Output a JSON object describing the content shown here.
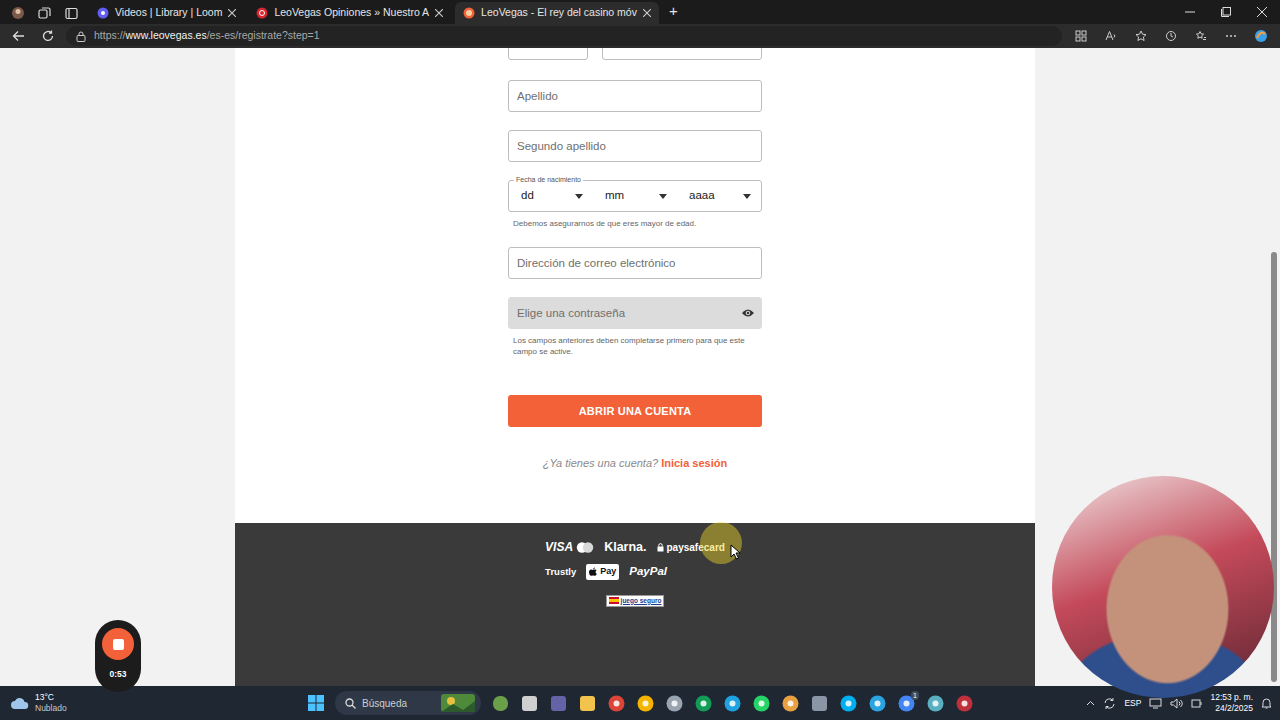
{
  "browser": {
    "tabs": [
      {
        "label": "Videos | Library | Loom",
        "selected": false,
        "kind": "loom"
      },
      {
        "label": "LeoVegas Opiniones » Nuestro A",
        "selected": false,
        "kind": "review"
      },
      {
        "label": "LeoVegas - El rey del casino móv",
        "selected": true,
        "kind": "leovegas"
      }
    ],
    "new_tab": "+",
    "url": {
      "scheme": "https://",
      "host": "www.leovegas.es",
      "path": "/es-es/registrate?step=1"
    }
  },
  "form": {
    "fields": [
      {
        "kind": "text",
        "placeholder": "Apellido",
        "disabled": false
      },
      {
        "kind": "text",
        "placeholder": "Segundo apellido",
        "disabled": false
      },
      {
        "kind": "date",
        "label": "Fecha de nacimiento",
        "parts": [
          "dd",
          "mm",
          "aaaa"
        ],
        "help": "Debemos asegurarnos de que eres mayor de edad."
      },
      {
        "kind": "text",
        "placeholder": "Dirección de correo electrónico",
        "disabled": false
      },
      {
        "kind": "password",
        "placeholder": "Elige una contraseña",
        "disabled": true,
        "help": "Los campos anteriores deben completarse primero para que este campo se active."
      }
    ],
    "submit": "ABRIR UNA CUENTA",
    "login_prompt": "¿Ya tienes una cuenta?",
    "login_link": "Inicia sesión"
  },
  "footer": {
    "payments": [
      [
        {
          "kind": "visa",
          "label": "VISA"
        },
        {
          "kind": "klarna",
          "label": "Klarna."
        },
        {
          "kind": "paysafe",
          "label": "paysafecard"
        }
      ],
      [
        {
          "kind": "trustly",
          "label": "Trustly"
        },
        {
          "kind": "applepay",
          "label": "Pay"
        },
        {
          "kind": "paypal",
          "label": "PayPal"
        }
      ]
    ],
    "badge": "juego seguro"
  },
  "recorder": {
    "time": "0:53"
  },
  "taskbar": {
    "weather": {
      "temp": "13°C",
      "condition": "Nublado"
    },
    "search": "Búsqueda",
    "app_badge": "1",
    "lang": "ESP",
    "time": "12:53 p. m.",
    "date": "24/2/2025"
  }
}
